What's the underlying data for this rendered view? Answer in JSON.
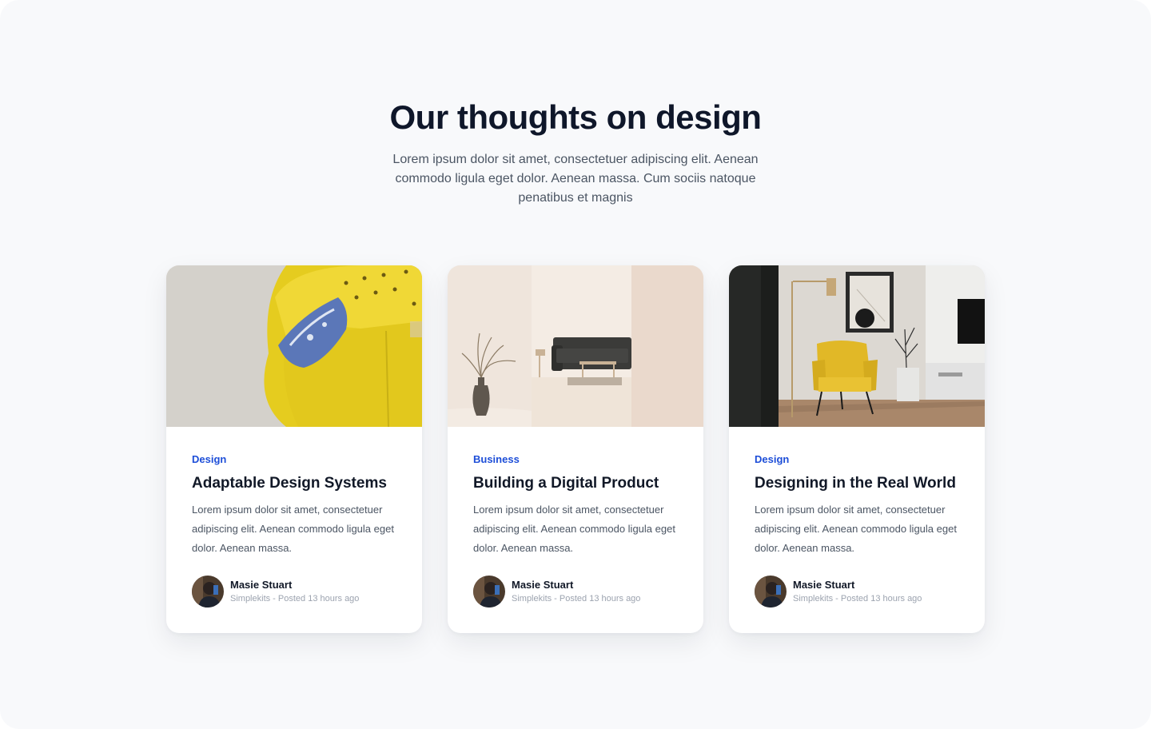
{
  "section": {
    "title": "Our thoughts on design",
    "subtitle": "Lorem ipsum dolor sit amet, consectetuer adipiscing elit. Aenean commodo ligula eget dolor. Aenean massa. Cum sociis natoque penatibus et magnis"
  },
  "colors": {
    "background": "#f8f9fb",
    "heading": "#0f172a",
    "category": "#1d4ed8",
    "body_text": "#4b5563",
    "meta_text": "#9ca3af"
  },
  "cards": [
    {
      "category": "Design",
      "title": "Adaptable Design Systems",
      "excerpt": "Lorem ipsum dolor sit amet, consectetuer adipiscing elit. Aenean commodo ligula eget dolor. Aenean massa.",
      "author_name": "Masie Stuart",
      "author_meta": "Simplekits - Posted 13 hours ago",
      "image": "yellow-sofa-photo"
    },
    {
      "category": "Business",
      "title": "Building a Digital Product",
      "excerpt": "Lorem ipsum dolor sit amet, consectetuer adipiscing elit. Aenean commodo ligula eget dolor. Aenean massa.",
      "author_name": "Masie Stuart",
      "author_meta": "Simplekits - Posted 13 hours ago",
      "image": "minimal-living-room-photo"
    },
    {
      "category": "Design",
      "title": "Designing in the Real World",
      "excerpt": "Lorem ipsum dolor sit amet, consectetuer adipiscing elit. Aenean commodo ligula eget dolor. Aenean massa.",
      "author_name": "Masie Stuart",
      "author_meta": "Simplekits - Posted 13 hours ago",
      "image": "yellow-armchair-room-photo"
    }
  ]
}
